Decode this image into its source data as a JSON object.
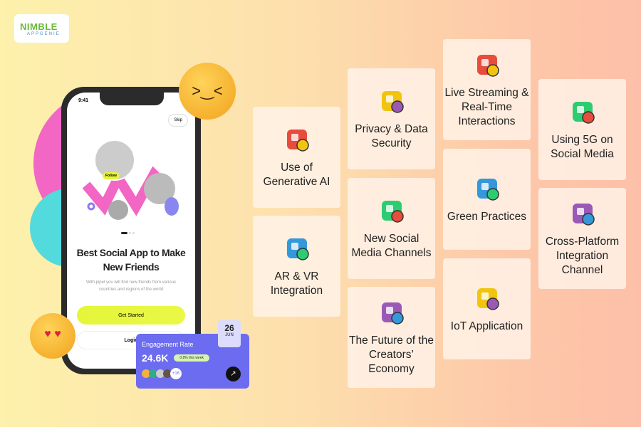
{
  "logo": {
    "line1": "NIMBLE",
    "line2": "APPGENIE"
  },
  "phone": {
    "time": "9:41",
    "skip": "Skip",
    "follow": "Follow",
    "headline": "Best Social App to Make New Friends",
    "subtext": "With pipel you will find new friends from various countries and regions of the world",
    "get_started": "Get Started",
    "login": "Login"
  },
  "engagement": {
    "title": "Engagement Rate",
    "value": "24.6K",
    "change": "0.8% this week",
    "extra_count": "+16",
    "date_day": "26",
    "date_month": "JUN"
  },
  "cards": [
    {
      "label": "Use of Generative AI",
      "icon": "ai-robot-icon"
    },
    {
      "label": "AR & VR Integration",
      "icon": "vr-cube-icon"
    },
    {
      "label": "Privacy & Data Security",
      "icon": "shield-check-icon"
    },
    {
      "label": "New Social Media Channels",
      "icon": "social-network-icon"
    },
    {
      "label": "The Future of the Creators’ Economy",
      "icon": "money-bulb-icon"
    },
    {
      "label": "Live Streaming & Real-Time Interactions",
      "icon": "live-broadcast-icon"
    },
    {
      "label": "Green Practices",
      "icon": "plant-hand-icon"
    },
    {
      "label": "IoT Application",
      "icon": "iot-network-icon"
    },
    {
      "label": "Using 5G on Social Media",
      "icon": "5g-phone-icon"
    },
    {
      "label": "Cross-Platform Integration Channel",
      "icon": "cloud-devices-icon"
    }
  ],
  "colors": {
    "accent_pink": "#f062c0",
    "accent_cyan": "#4fd8dc",
    "lime": "#e4f53a",
    "engagement_bg": "#6c6cf0"
  }
}
